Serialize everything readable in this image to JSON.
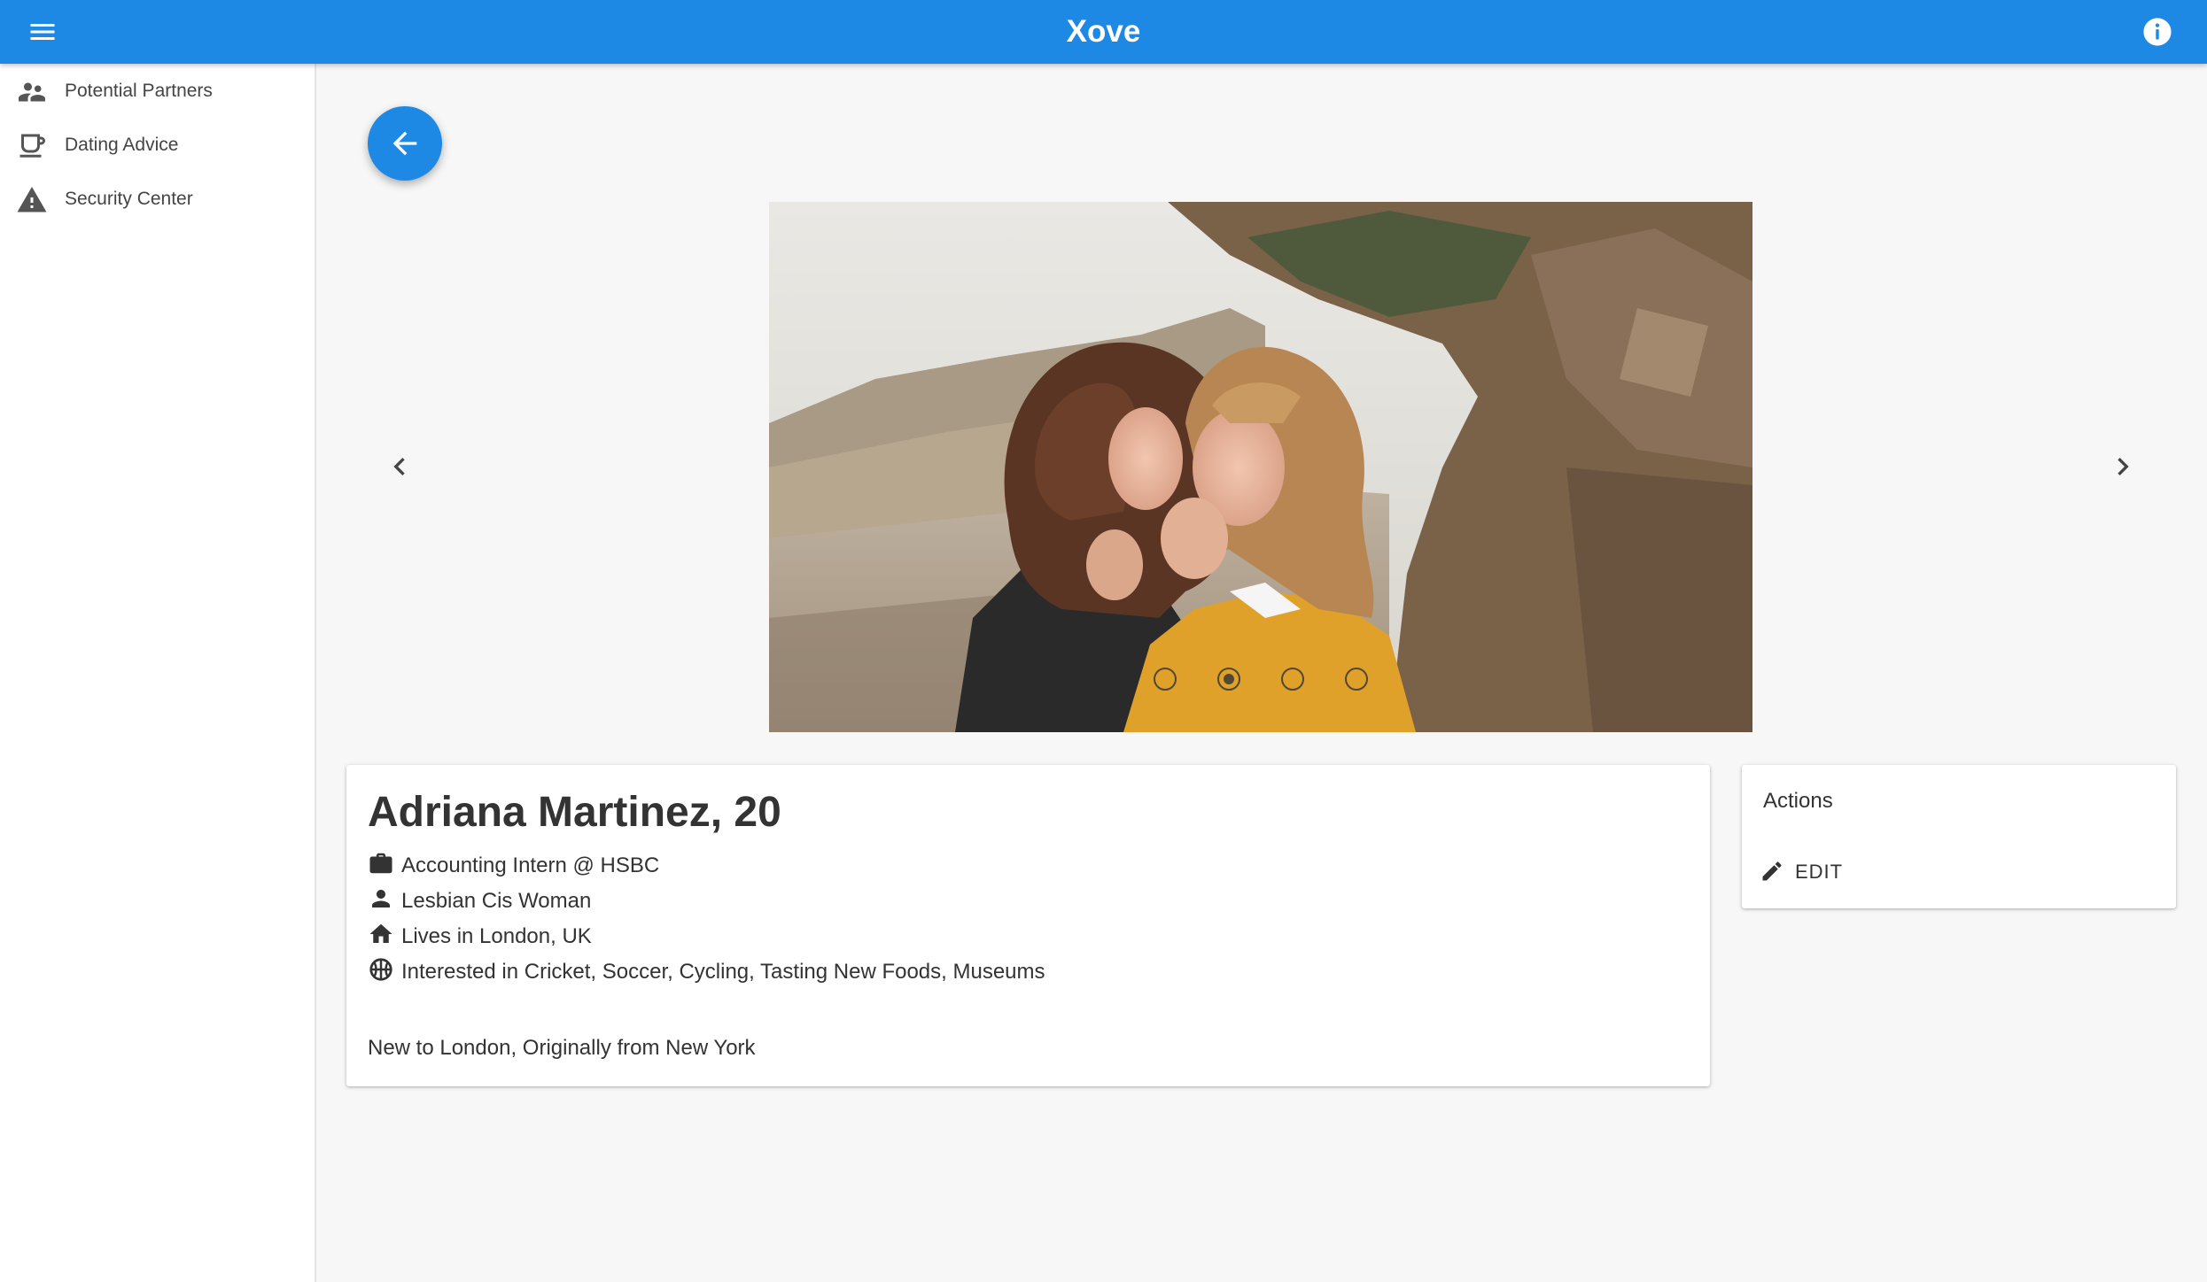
{
  "appbar": {
    "title": "Xove",
    "color": "#1e88e5",
    "menu_icon": "hamburger-menu-icon",
    "info_icon": "info-icon"
  },
  "sidebar": {
    "items": [
      {
        "label": "Potential Partners",
        "icon": "people-icon"
      },
      {
        "label": "Dating Advice",
        "icon": "coffee-cup-icon"
      },
      {
        "label": "Security Center",
        "icon": "warning-icon"
      }
    ]
  },
  "back_button": {
    "icon": "arrow-left-icon"
  },
  "carousel": {
    "slide_count": 4,
    "active_index": 1,
    "prev_icon": "chevron-left-icon",
    "next_icon": "chevron-right-icon"
  },
  "profile": {
    "name": "Adriana Martinez, 20",
    "details": [
      {
        "icon": "briefcase-icon",
        "text": "Accounting Intern @ HSBC"
      },
      {
        "icon": "person-icon",
        "text": "Lesbian Cis Woman"
      },
      {
        "icon": "home-icon",
        "text": "Lives in London, UK"
      },
      {
        "icon": "sports-ball-icon",
        "text": "Interested in Cricket, Soccer, Cycling, Tasting New Foods, Museums"
      }
    ],
    "bio": "New to London, Originally from New York"
  },
  "actions": {
    "title": "Actions",
    "edit_label": "EDIT",
    "edit_icon": "pencil-icon"
  }
}
